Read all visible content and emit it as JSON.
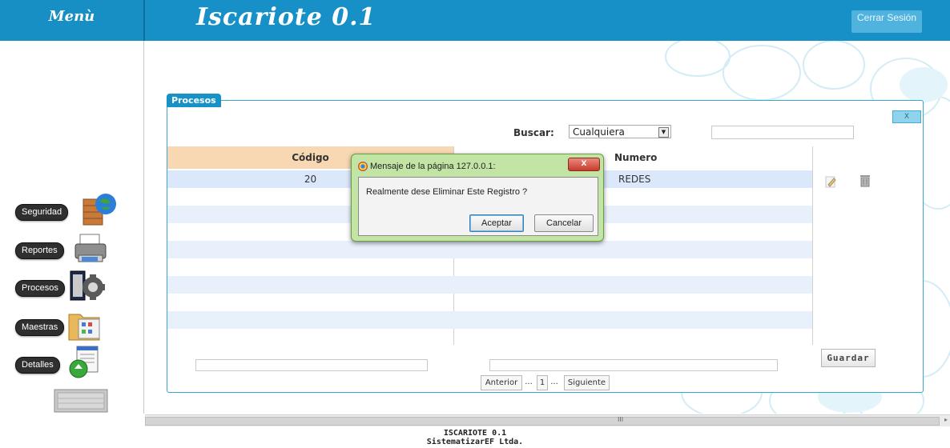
{
  "header": {
    "menu_title": "Menù",
    "app_title": "Iscariote 0.1",
    "logout_label": "Cerrar Sesión"
  },
  "sidebar": {
    "items": [
      {
        "label": "Seguridad",
        "icon": "security-globe-wall-icon"
      },
      {
        "label": "Reportes",
        "icon": "printer-icon"
      },
      {
        "label": "Procesos",
        "icon": "process-gear-icon"
      },
      {
        "label": "Maestras",
        "icon": "folder-icon"
      },
      {
        "label": "Detalles",
        "icon": "details-document-icon"
      }
    ],
    "bottom_icon": "keyboard-icon"
  },
  "panel": {
    "title": "Procesos",
    "close_label": "X",
    "search": {
      "label": "Buscar:",
      "selected": "Cualquiera",
      "value": ""
    },
    "table": {
      "columns": [
        "Código",
        "Numero"
      ],
      "rows": [
        {
          "codigo": "20",
          "numero": "REDES"
        }
      ]
    },
    "save_label": "Guardar",
    "pager": {
      "prev": "Anterior",
      "dots1": "...",
      "page": "1",
      "dots2": "...",
      "next": "Siguiente"
    }
  },
  "dialog": {
    "title": "Mensaje de la página 127.0.0.1:",
    "close_label": "X",
    "message": "Realmente dese Eliminar Este Registro ?",
    "ok_label": "Aceptar",
    "cancel_label": "Cancelar"
  },
  "scrollbar": {
    "grip": "III"
  },
  "footer": {
    "line1": "ISCARIOTE 0.1",
    "line2": "SistematizarEF Ltda."
  },
  "colors": {
    "accent": "#1690c6",
    "header_col_bg": "#f8d8b2",
    "dialog_frame": "#c2e4a5"
  }
}
